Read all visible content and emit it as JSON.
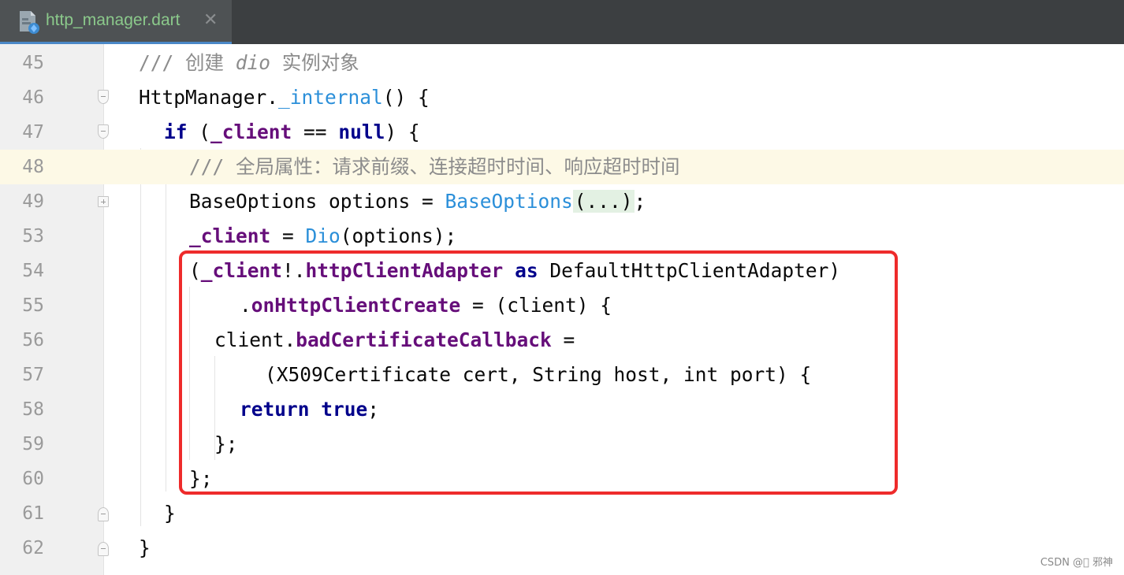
{
  "tab": {
    "filename": "http_manager.dart",
    "close_glyph": "✕",
    "icon": "dart-file-icon",
    "name_color": "#8bc98b"
  },
  "lines": [
    {
      "no": "45",
      "tokens": [
        {
          "t": "/// 创建 ",
          "c": "comment"
        },
        {
          "t": "dio",
          "c": "comment-it"
        },
        {
          "t": " 实例对象",
          "c": "comment"
        }
      ]
    },
    {
      "no": "46",
      "tokens": [
        {
          "t": "HttpManager.",
          "c": ""
        },
        {
          "t": "_internal",
          "c": "fn"
        },
        {
          "t": "() {",
          "c": ""
        }
      ]
    },
    {
      "no": "47",
      "tokens": [
        {
          "t": "if",
          "c": "kw"
        },
        {
          "t": " (",
          "c": ""
        },
        {
          "t": "_client",
          "c": "field"
        },
        {
          "t": " == ",
          "c": ""
        },
        {
          "t": "null",
          "c": "kw"
        },
        {
          "t": ") {",
          "c": ""
        }
      ]
    },
    {
      "no": "48",
      "tokens": [
        {
          "t": "/// 全局属性：请求前缀、连接超时时间、响应超时时间",
          "c": "comment"
        }
      ]
    },
    {
      "no": "49",
      "tokens": [
        {
          "t": "BaseOptions options = ",
          "c": ""
        },
        {
          "t": "BaseOptions",
          "c": "fn"
        },
        {
          "t": "(...)",
          "c": "folded"
        },
        {
          "t": ";",
          "c": ""
        }
      ]
    },
    {
      "no": "53",
      "tokens": [
        {
          "t": "_client",
          "c": "field"
        },
        {
          "t": " = ",
          "c": ""
        },
        {
          "t": "Dio",
          "c": "fn"
        },
        {
          "t": "(options);",
          "c": ""
        }
      ]
    },
    {
      "no": "54",
      "tokens": [
        {
          "t": "(",
          "c": ""
        },
        {
          "t": "_client",
          "c": "field"
        },
        {
          "t": "!.",
          "c": ""
        },
        {
          "t": "httpClientAdapter",
          "c": "field"
        },
        {
          "t": " ",
          "c": ""
        },
        {
          "t": "as",
          "c": "kw"
        },
        {
          "t": " DefaultHttpClientAdapter)",
          "c": ""
        }
      ]
    },
    {
      "no": "55",
      "tokens": [
        {
          "t": ".",
          "c": ""
        },
        {
          "t": "onHttpClientCreate",
          "c": "field"
        },
        {
          "t": " = (client) {",
          "c": ""
        }
      ]
    },
    {
      "no": "56",
      "tokens": [
        {
          "t": "client.",
          "c": ""
        },
        {
          "t": "badCertificateCallback",
          "c": "field"
        },
        {
          "t": " =",
          "c": ""
        }
      ]
    },
    {
      "no": "57",
      "tokens": [
        {
          "t": "(X509Certificate cert, String host, int port) {",
          "c": ""
        }
      ]
    },
    {
      "no": "58",
      "tokens": [
        {
          "t": "return",
          "c": "kw"
        },
        {
          "t": " ",
          "c": ""
        },
        {
          "t": "true",
          "c": "kw"
        },
        {
          "t": ";",
          "c": ""
        }
      ]
    },
    {
      "no": "59",
      "tokens": [
        {
          "t": "};",
          "c": ""
        }
      ]
    },
    {
      "no": "60",
      "tokens": [
        {
          "t": "};",
          "c": ""
        }
      ]
    },
    {
      "no": "61",
      "tokens": [
        {
          "t": "}",
          "c": ""
        }
      ]
    },
    {
      "no": "62",
      "tokens": [
        {
          "t": "}",
          "c": ""
        }
      ]
    }
  ],
  "watermark": "CSDN @\u0000 邪神",
  "colors": {
    "highlight_box": "#ee2b2b",
    "current_line": "#fdf9e6",
    "keyword": "#00008b",
    "function": "#2b8fd9",
    "field": "#660e7a",
    "comment": "#8c8c8c"
  }
}
